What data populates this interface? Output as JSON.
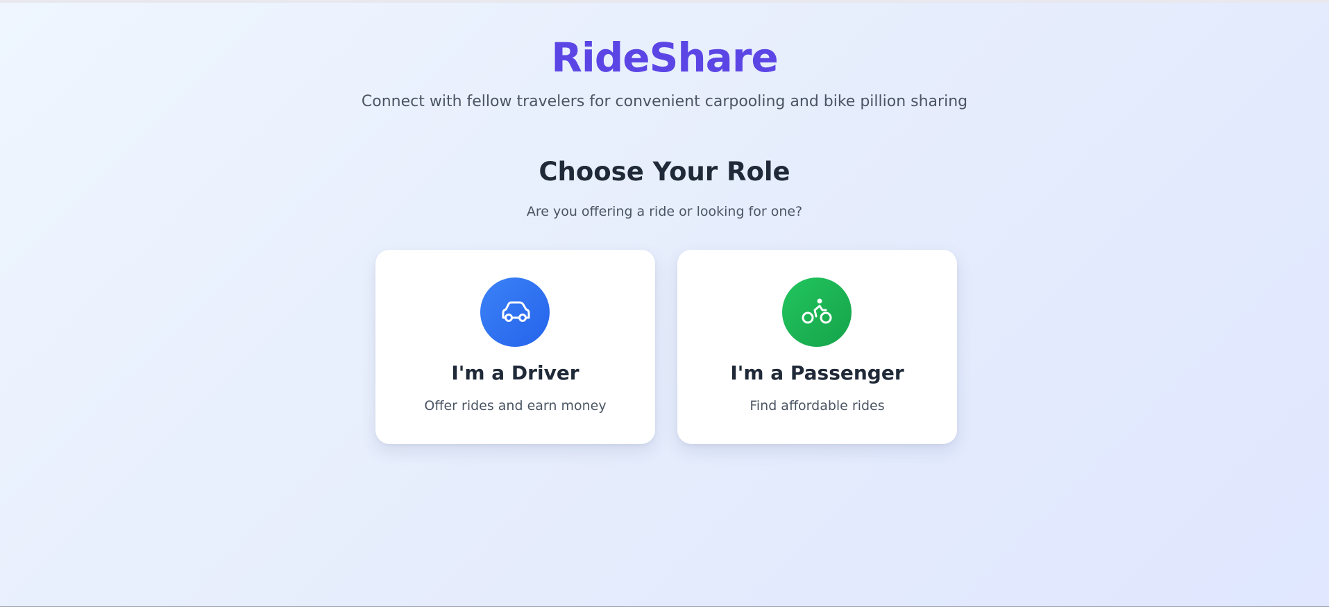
{
  "header": {
    "brand": "RideShare",
    "tagline": "Connect with fellow travelers for convenient carpooling and bike pillion sharing"
  },
  "role_section": {
    "title": "Choose Your Role",
    "subtitle": "Are you offering a ride or looking for one?"
  },
  "roles": [
    {
      "title": "I'm a Driver",
      "description": "Offer rides and earn money",
      "icon": "car-icon",
      "accent": "#2563eb"
    },
    {
      "title": "I'm a Passenger",
      "description": "Find affordable rides",
      "icon": "bike-icon",
      "accent": "#16a34a"
    }
  ],
  "colors": {
    "brand": "#5b46e5",
    "background": "#e6edfc"
  }
}
